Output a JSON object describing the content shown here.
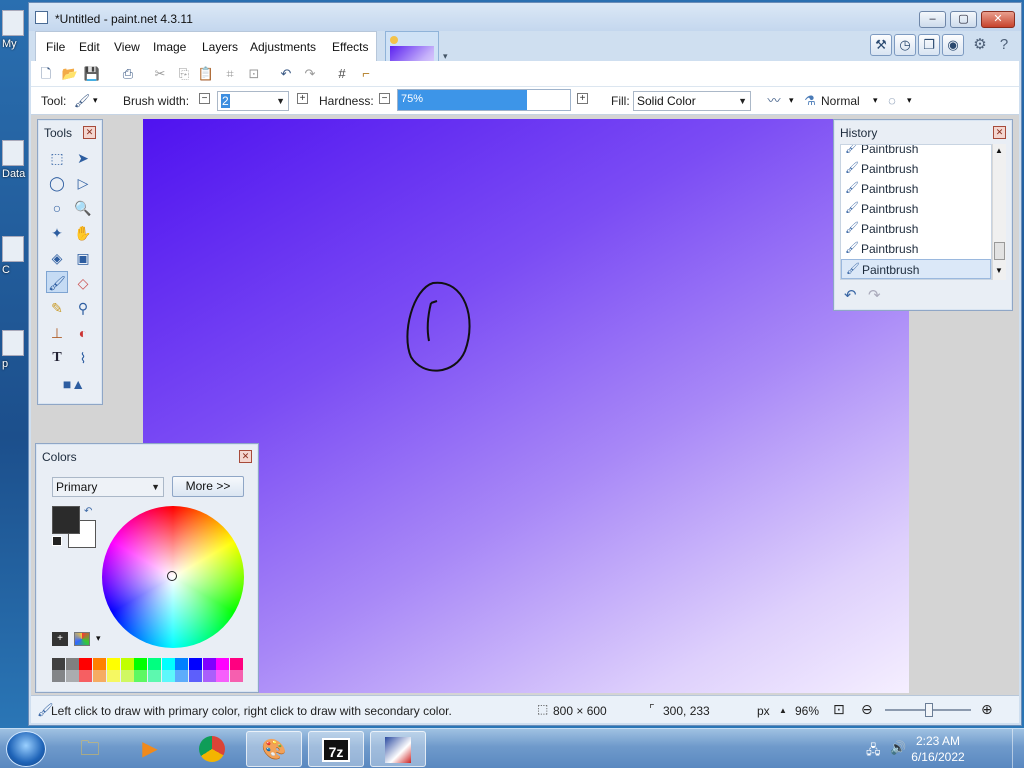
{
  "window": {
    "title": "*Untitled - paint.net 4.3.11"
  },
  "desktop_icons": [
    {
      "label": "My"
    },
    {
      "label": "Data"
    },
    {
      "label": "C"
    },
    {
      "label": "p"
    }
  ],
  "menu": [
    "File",
    "Edit",
    "View",
    "Image",
    "Layers",
    "Adjustments",
    "Effects"
  ],
  "toolbar": {
    "tool_label": "Tool:",
    "brush_width_label": "Brush width:",
    "brush_width_value": "2",
    "hardness_label": "Hardness:",
    "hardness_value": "75%",
    "hardness_fraction": 0.75,
    "fill_label": "Fill:",
    "fill_value": "Solid Color",
    "blend_value": "Normal"
  },
  "tools_panel": {
    "title": "Tools"
  },
  "history_panel": {
    "title": "History",
    "items": [
      "Paintbrush",
      "Paintbrush",
      "Paintbrush",
      "Paintbrush",
      "Paintbrush",
      "Paintbrush",
      "Paintbrush"
    ]
  },
  "colors_panel": {
    "title": "Colors",
    "mode": "Primary",
    "more_label": "More >>",
    "primary_color": "#2b2b2b",
    "secondary_color": "#ffffff"
  },
  "palette": [
    "#404040",
    "#808080",
    "#ff0000",
    "#ff8000",
    "#ffff00",
    "#c0ff00",
    "#00ff00",
    "#00ff80",
    "#00ffff",
    "#0080ff",
    "#0000ff",
    "#8000ff",
    "#ff00ff",
    "#ff0080"
  ],
  "status": {
    "hint": "Left click to draw with primary color, right click to draw with secondary color.",
    "size": "800 × 600",
    "cursor": "300, 233",
    "unit": "px",
    "zoom": "96%"
  },
  "clock": {
    "time": "2:23 AM",
    "date": "6/16/2022"
  },
  "taskbar": {
    "zip_label": "7z"
  }
}
